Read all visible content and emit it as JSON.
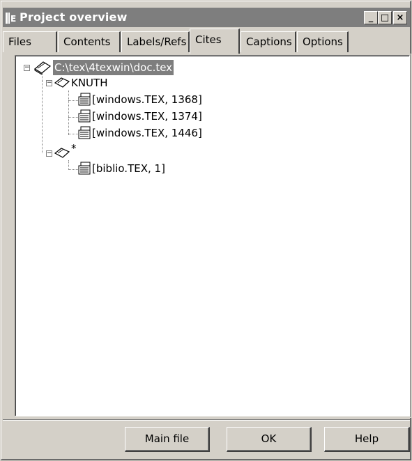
{
  "window": {
    "title": "Project overview",
    "minimize": "_",
    "maximize": "□",
    "close": "×"
  },
  "tabs": [
    {
      "label": "Files"
    },
    {
      "label": "Contents"
    },
    {
      "label": "Labels/Refs"
    },
    {
      "label": "Cites",
      "active": true
    },
    {
      "label": "Captions"
    },
    {
      "label": "Options"
    }
  ],
  "tree": {
    "root": "C:\\tex\\4texwin\\doc.tex",
    "groups": [
      {
        "label": "KNUTH",
        "items": [
          "[windows.TEX, 1368]",
          "[windows.TEX, 1374]",
          "[windows.TEX, 1446]"
        ]
      },
      {
        "label": "*",
        "items": [
          "[biblio.TEX, 1]"
        ]
      }
    ]
  },
  "buttons": {
    "main_file": "Main file",
    "ok": "OK",
    "help": "Help"
  },
  "icons": {
    "app": "tex-app-icon",
    "book": "book-icon",
    "open_book": "open-book-icon",
    "cite": "citation-page-icon"
  }
}
